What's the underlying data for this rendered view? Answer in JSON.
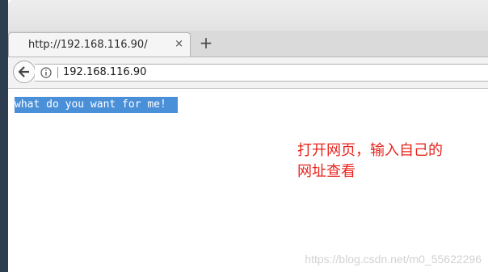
{
  "browser": {
    "tab": {
      "title": "http://192.168.116.90/",
      "close_glyph": "×"
    },
    "new_tab_glyph": "+",
    "address_bar": {
      "url": "192.168.116.90"
    }
  },
  "page": {
    "selected_text": "what do you want for me!",
    "note_line1": "打开网页，输入自己的",
    "note_line2": "网址查看"
  },
  "watermark": "https://blog.csdn.net/m0_55622296",
  "colors": {
    "selection": "#4a90d9",
    "note": "#e8231c",
    "desktop": "#2c3e4f"
  },
  "icons": {
    "back": "back-arrow-icon",
    "info": "info-icon",
    "close": "close-icon",
    "new_tab": "plus-icon"
  }
}
